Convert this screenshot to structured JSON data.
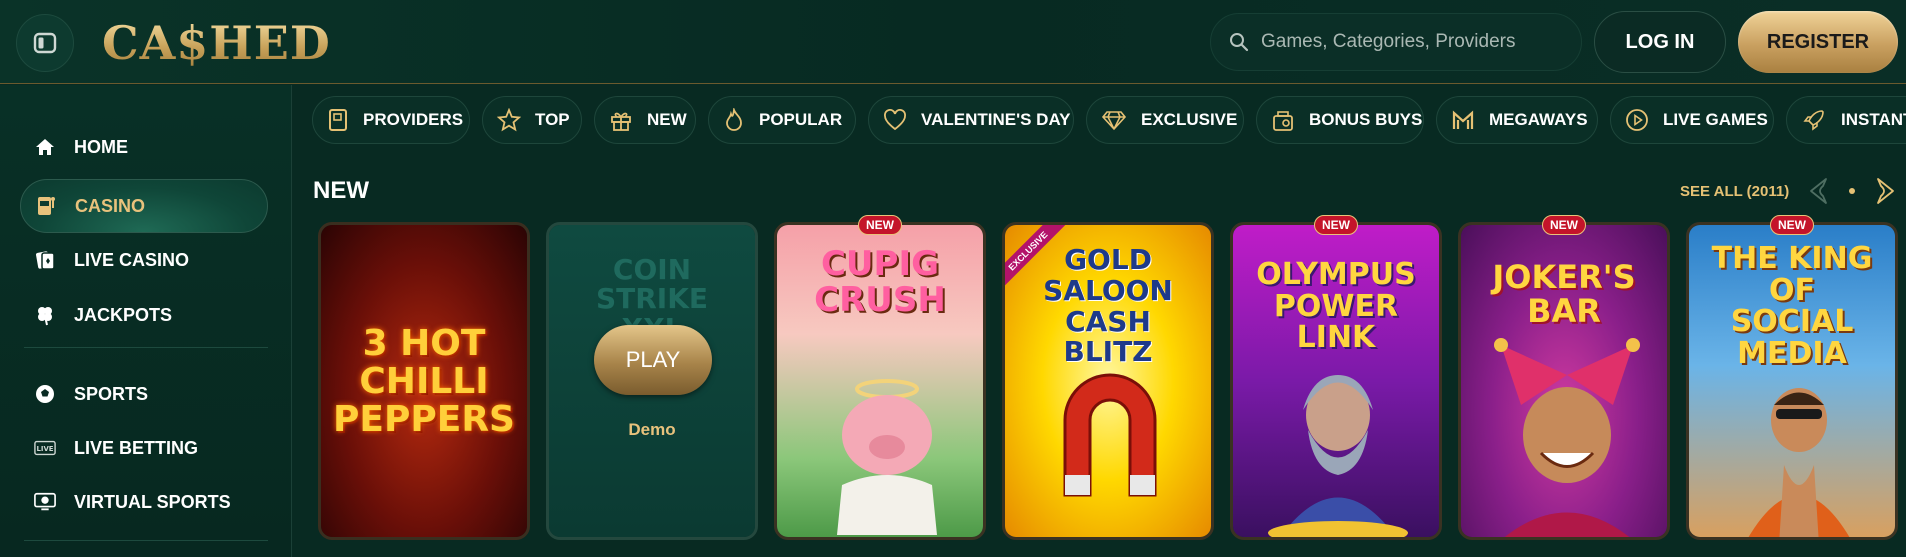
{
  "header": {
    "logo": "CA$HED",
    "search_placeholder": "Games, Categories, Providers",
    "login_label": "LOG IN",
    "register_label": "REGISTER"
  },
  "sidebar": {
    "items": [
      {
        "label": "HOME",
        "icon": "home-icon"
      },
      {
        "label": "CASINO",
        "icon": "slot-machine-icon",
        "active": true
      },
      {
        "label": "LIVE CASINO",
        "icon": "cards-icon"
      },
      {
        "label": "JACKPOTS",
        "icon": "clover-icon"
      },
      {
        "label": "SPORTS",
        "icon": "soccer-ball-icon"
      },
      {
        "label": "LIVE BETTING",
        "icon": "live-icon"
      },
      {
        "label": "VIRTUAL SPORTS",
        "icon": "virtual-sports-icon"
      }
    ]
  },
  "categories": [
    {
      "label": "PROVIDERS",
      "icon": "book-icon"
    },
    {
      "label": "TOP",
      "icon": "star-icon"
    },
    {
      "label": "NEW",
      "icon": "gift-icon"
    },
    {
      "label": "POPULAR",
      "icon": "flame-icon"
    },
    {
      "label": "VALENTINE'S DAY",
      "icon": "heart-icon"
    },
    {
      "label": "EXCLUSIVE",
      "icon": "diamond-icon"
    },
    {
      "label": "BONUS BUYS",
      "icon": "bonus-icon"
    },
    {
      "label": "MEGAWAYS",
      "icon": "megaways-icon"
    },
    {
      "label": "LIVE GAMES",
      "icon": "play-circle-icon"
    },
    {
      "label": "INSTANT",
      "icon": "rocket-icon"
    }
  ],
  "section": {
    "title": "NEW",
    "see_all": "SEE ALL (2011)"
  },
  "games": [
    {
      "title": "3 HOT CHILLI PEPPERS",
      "badge": ""
    },
    {
      "title": "COIN STRIKE XXL",
      "badge": "",
      "play_label": "PLAY",
      "demo_label": "Demo"
    },
    {
      "title": "CUPIG CRUSH",
      "badge": "NEW"
    },
    {
      "title": "GOLD SALOON CASH BLITZ",
      "badge": "",
      "exclusive": "EXCLUSIVE"
    },
    {
      "title": "OLYMPUS POWER LINK",
      "badge": "NEW"
    },
    {
      "title": "JOKER'S BAR",
      "badge": "NEW"
    },
    {
      "title": "THE KING OF SOCIAL MEDIA",
      "badge": "NEW"
    }
  ],
  "colors": {
    "background": "#082a22",
    "accent_gold": "#e5c174",
    "badge_red": "#c4142a"
  }
}
